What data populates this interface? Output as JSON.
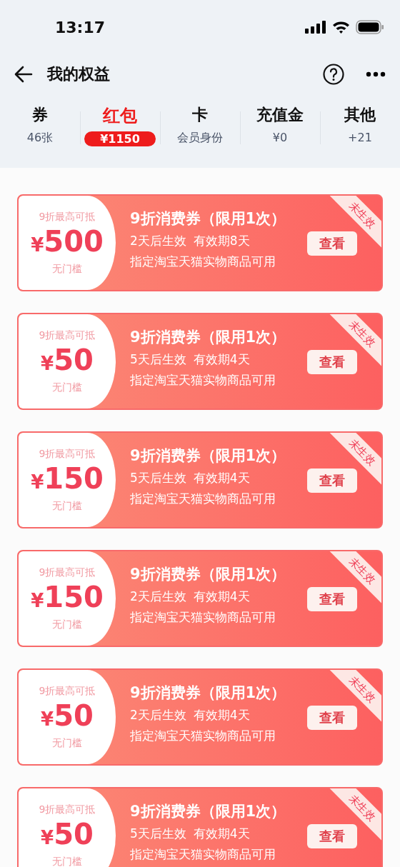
{
  "status_bar": {
    "time": "13:17"
  },
  "nav": {
    "title": "我的权益"
  },
  "tabs": [
    {
      "label": "券",
      "sub": "46张",
      "selected": false
    },
    {
      "label": "红包",
      "sub": "¥1150",
      "selected": true
    },
    {
      "label": "卡",
      "sub": "会员身份",
      "selected": false
    },
    {
      "label": "充值金",
      "sub": "¥0",
      "selected": false
    },
    {
      "label": "其他",
      "sub": "+21",
      "selected": false
    }
  ],
  "coupons": [
    {
      "cap": "9折最高可抵",
      "currency": "¥",
      "amount": "500",
      "threshold": "无门槛",
      "title": "9折消费券（限用1次）",
      "starts": "2天后生效",
      "validity": "有效期8天",
      "scope": "指定淘宝天猫实物商品可用",
      "button": "查看",
      "ribbon": "未生效"
    },
    {
      "cap": "9折最高可抵",
      "currency": "¥",
      "amount": "50",
      "threshold": "无门槛",
      "title": "9折消费券（限用1次）",
      "starts": "5天后生效",
      "validity": "有效期4天",
      "scope": "指定淘宝天猫实物商品可用",
      "button": "查看",
      "ribbon": "未生效"
    },
    {
      "cap": "9折最高可抵",
      "currency": "¥",
      "amount": "150",
      "threshold": "无门槛",
      "title": "9折消费券（限用1次）",
      "starts": "5天后生效",
      "validity": "有效期4天",
      "scope": "指定淘宝天猫实物商品可用",
      "button": "查看",
      "ribbon": "未生效"
    },
    {
      "cap": "9折最高可抵",
      "currency": "¥",
      "amount": "150",
      "threshold": "无门槛",
      "title": "9折消费券（限用1次）",
      "starts": "2天后生效",
      "validity": "有效期4天",
      "scope": "指定淘宝天猫实物商品可用",
      "button": "查看",
      "ribbon": "未生效"
    },
    {
      "cap": "9折最高可抵",
      "currency": "¥",
      "amount": "50",
      "threshold": "无门槛",
      "title": "9折消费券（限用1次）",
      "starts": "2天后生效",
      "validity": "有效期4天",
      "scope": "指定淘宝天猫实物商品可用",
      "button": "查看",
      "ribbon": "未生效"
    },
    {
      "cap": "9折最高可抵",
      "currency": "¥",
      "amount": "50",
      "threshold": "无门槛",
      "title": "9折消费券（限用1次）",
      "starts": "5天后生效",
      "validity": "有效期4天",
      "scope": "指定淘宝天猫实物商品可用",
      "button": "查看",
      "ribbon": "未生效"
    }
  ]
}
